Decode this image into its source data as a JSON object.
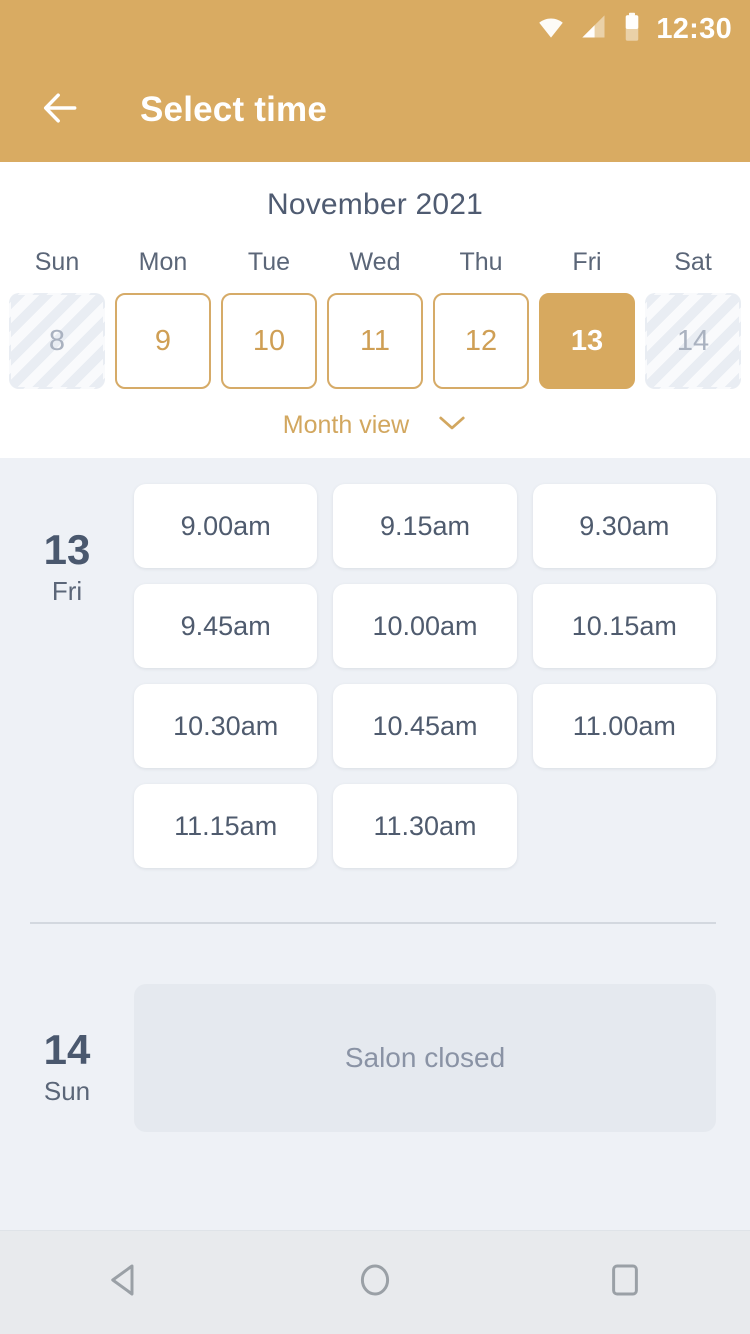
{
  "status_bar": {
    "time": "12:30",
    "icons": [
      "wifi-icon",
      "cellular-signal-icon",
      "battery-icon"
    ]
  },
  "app_bar": {
    "back_icon": "arrow-left-icon",
    "title": "Select time"
  },
  "calendar": {
    "month_title": "November 2021",
    "weekdays": [
      "Sun",
      "Mon",
      "Tue",
      "Wed",
      "Thu",
      "Fri",
      "Sat"
    ],
    "days": [
      {
        "number": "8",
        "state": "disabled"
      },
      {
        "number": "9",
        "state": "available"
      },
      {
        "number": "10",
        "state": "available"
      },
      {
        "number": "11",
        "state": "available"
      },
      {
        "number": "12",
        "state": "available"
      },
      {
        "number": "13",
        "state": "selected"
      },
      {
        "number": "14",
        "state": "disabled"
      }
    ],
    "month_view_label": "Month view",
    "month_view_icon": "chevron-down-icon"
  },
  "schedule": {
    "days": [
      {
        "day_number": "13",
        "day_name": "Fri",
        "slots": [
          "9.00am",
          "9.15am",
          "9.30am",
          "9.45am",
          "10.00am",
          "10.15am",
          "10.30am",
          "10.45am",
          "11.00am",
          "11.15am",
          "11.30am"
        ]
      },
      {
        "day_number": "14",
        "day_name": "Sun",
        "closed_label": "Salon closed"
      }
    ]
  },
  "nav_bar": {
    "back_icon": "nav-back-triangle-icon",
    "home_icon": "nav-home-circle-icon",
    "recents_icon": "nav-recents-square-icon"
  },
  "colors": {
    "accent_gold": "#d9ab62",
    "selected_day": "#d7a95f",
    "panel_bg": "#ffffff",
    "body_bg": "#eef1f6",
    "slot_card": "#ffffff",
    "closed_card": "#e5e9ef",
    "text_slate": "#4f5b71",
    "nav_bar_bg": "#e8eaed"
  }
}
